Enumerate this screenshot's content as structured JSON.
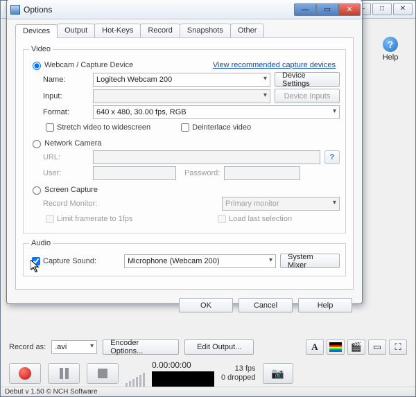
{
  "outer_window": {
    "win_controls": {
      "min": "—",
      "max": "□",
      "close": "✕"
    }
  },
  "help": {
    "glyph": "?",
    "label": "Help"
  },
  "options": {
    "title": "Options",
    "win_controls": {
      "min": "—",
      "max": "▭",
      "close": "✕"
    },
    "tabs": [
      "Devices",
      "Output",
      "Hot-Keys",
      "Record",
      "Snapshots",
      "Other"
    ],
    "video": {
      "legend": "Video",
      "radio_webcam": "Webcam / Capture Device",
      "link_recommended": "View recommended capture devices",
      "name_label": "Name:",
      "name_value": "Logitech Webcam 200",
      "device_settings": "Device Settings",
      "input_label": "Input:",
      "input_value": "",
      "device_inputs": "Device Inputs",
      "format_label": "Format:",
      "format_value": "640 x 480, 30.00 fps, RGB",
      "chk_widescreen": "Stretch video to widescreen",
      "chk_deinterlace": "Deinterlace video",
      "radio_network": "Network Camera",
      "url_label": "URL:",
      "user_label": "User:",
      "pass_label": "Password:",
      "radio_screen": "Screen Capture",
      "record_monitor_label": "Record Monitor:",
      "record_monitor_value": "Primary monitor",
      "chk_limit_fps": "Limit framerate to 1fps",
      "chk_load_last": "Load last selection",
      "net_help_glyph": "?"
    },
    "audio": {
      "legend": "Audio",
      "chk_capture": "Capture Sound:",
      "source_value": "Microphone (Webcam 200)",
      "system_mixer": "System Mixer"
    },
    "buttons": {
      "ok": "OK",
      "cancel": "Cancel",
      "help": "Help"
    }
  },
  "bottom": {
    "record_as_label": "Record as:",
    "record_as_value": ".avi",
    "encoder_options": "Encoder Options...",
    "edit_output": "Edit Output...",
    "tool_icons": {
      "text": "A",
      "color": "▤",
      "filter": "🎬",
      "window": "▭",
      "fullscreen": "⛶"
    },
    "time": "0.00:00:00",
    "stats": {
      "fps": "13 fps",
      "dropped": "0 dropped"
    },
    "camera_glyph": "📷"
  },
  "statusbar": "Debut v 1.50 © NCH Software"
}
